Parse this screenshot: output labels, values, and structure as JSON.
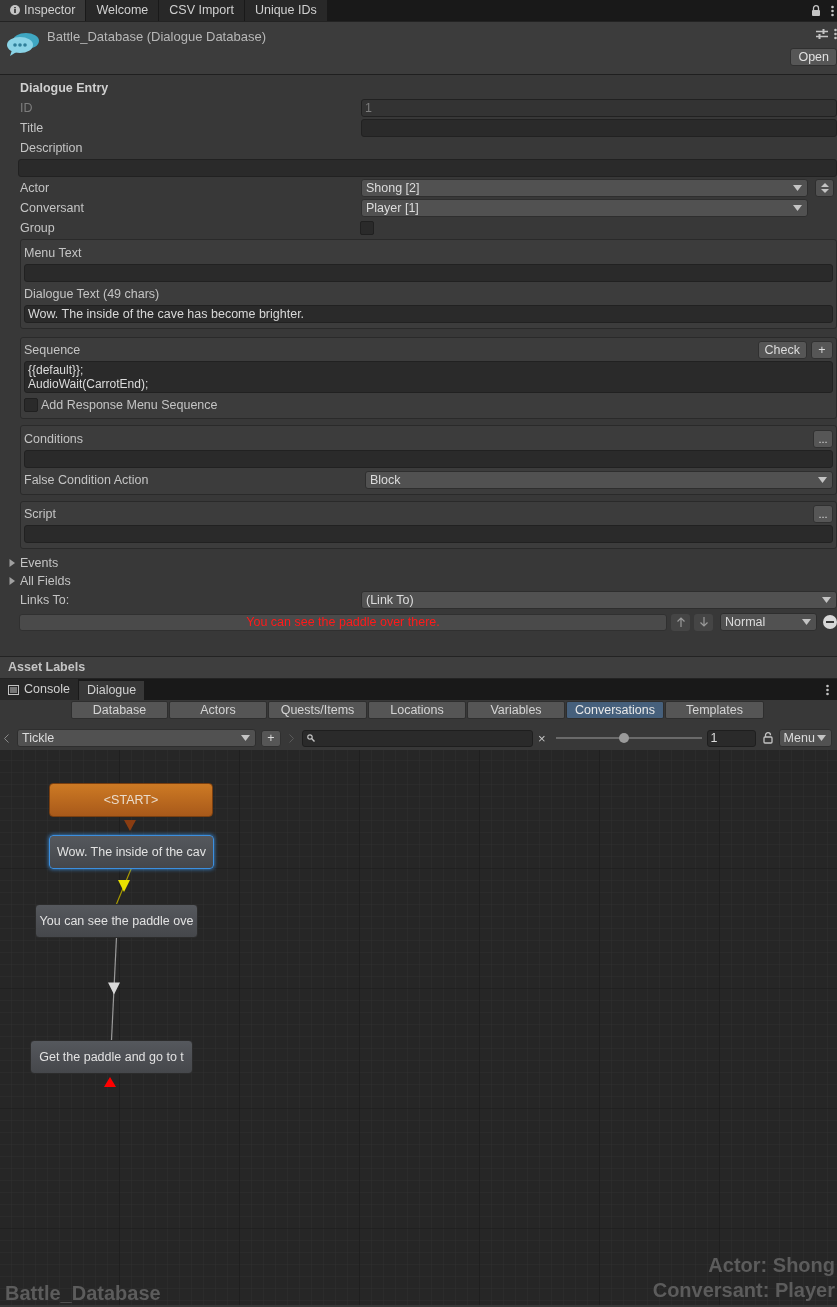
{
  "inspector_tabs": [
    {
      "label": "Inspector",
      "selected": true
    },
    {
      "label": "Welcome",
      "selected": false
    },
    {
      "label": "CSV Import",
      "selected": false
    },
    {
      "label": "Unique IDs",
      "selected": false
    }
  ],
  "asset": {
    "title": "Battle_Database (Dialogue Database)",
    "open_button": "Open"
  },
  "entry": {
    "heading": "Dialogue Entry",
    "id": {
      "label": "ID",
      "value": "1"
    },
    "title": {
      "label": "Title"
    },
    "description": {
      "label": "Description"
    },
    "actor": {
      "label": "Actor",
      "value": "Shong [2]"
    },
    "conversant": {
      "label": "Conversant",
      "value": "Player [1]"
    },
    "group": {
      "label": "Group",
      "checked": false
    }
  },
  "menu_text": {
    "label": "Menu Text"
  },
  "dialogue_text": {
    "label": "Dialogue Text (49 chars)",
    "value": "Wow. The inside of the cave has become brighter."
  },
  "sequence": {
    "label": "Sequence",
    "check_button": "Check",
    "add_button": "+",
    "lines": [
      "{{default}};",
      "AudioWait(CarrotEnd);"
    ],
    "response_menu": {
      "label": "Add Response Menu Sequence",
      "checked": false
    }
  },
  "conditions": {
    "label": "Conditions",
    "button": "...",
    "false_action": {
      "label": "False Condition Action",
      "value": "Block"
    }
  },
  "script": {
    "label": "Script",
    "button": "..."
  },
  "foldouts": [
    {
      "label": "Events",
      "expanded": false
    },
    {
      "label": "All Fields",
      "expanded": false
    }
  ],
  "links": {
    "label": "Links To:",
    "value": "(Link To)",
    "items": [
      {
        "text": "You can see the paddle over there.",
        "priority": "Normal"
      }
    ]
  },
  "asset_labels": "Asset Labels",
  "panel_tabs": [
    {
      "label": "Console",
      "selected": false
    },
    {
      "label": "Dialogue",
      "selected": true
    }
  ],
  "editor_tabs": [
    {
      "label": "Database",
      "selected": false
    },
    {
      "label": "Actors",
      "selected": false
    },
    {
      "label": "Quests/Items",
      "selected": false
    },
    {
      "label": "Locations",
      "selected": false
    },
    {
      "label": "Variables",
      "selected": false
    },
    {
      "label": "Conversations",
      "selected": true
    },
    {
      "label": "Templates",
      "selected": false
    }
  ],
  "toolbar": {
    "conversation": "Tickle",
    "add_button": "+",
    "clear": "×",
    "zoom": {
      "level": 0.47
    },
    "zoom_value": "1",
    "menu": "Menu"
  },
  "nodes": [
    {
      "text": "<START>",
      "kind": "start",
      "selected": false
    },
    {
      "text": "Wow. The inside of the cav",
      "kind": "dialogue",
      "selected": true
    },
    {
      "text": "You can see the paddle ove",
      "kind": "dialogue",
      "selected": false
    },
    {
      "text": "Get the paddle and go to t",
      "kind": "dialogue",
      "selected": false
    }
  ],
  "footer": {
    "database": "Battle_Database",
    "actor": "Actor: Shong",
    "conversant": "Conversant: Player"
  }
}
